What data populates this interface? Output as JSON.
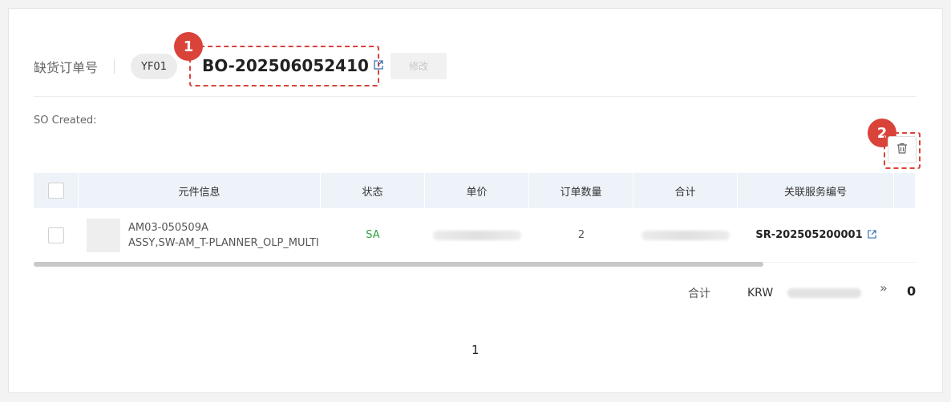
{
  "header": {
    "order_label": "缺货订单号",
    "tag": "YF01",
    "order_number": "BO-202506052410",
    "edit_button": "修改"
  },
  "badges": [
    "1",
    "2"
  ],
  "so_created_label": "SO Created:",
  "table": {
    "columns": [
      "元件信息",
      "状态",
      "单价",
      "订单数量",
      "合计",
      "关联服务编号"
    ],
    "rows": [
      {
        "part_code": "AM03-050509A",
        "part_name": "ASSY,SW-AM_T-PLANNER_OLP_MULTI",
        "status": "SA",
        "quantity": "2",
        "service_number": "SR-202505200001"
      }
    ]
  },
  "totals": {
    "label": "合计",
    "currency": "KRW",
    "extra": "0"
  },
  "pagination": {
    "current": "1"
  },
  "colors": {
    "accent_red": "#d9433a",
    "status_green": "#2e9e3e",
    "header_bg": "#edf3f9",
    "link_blue": "#3a6fb0"
  }
}
